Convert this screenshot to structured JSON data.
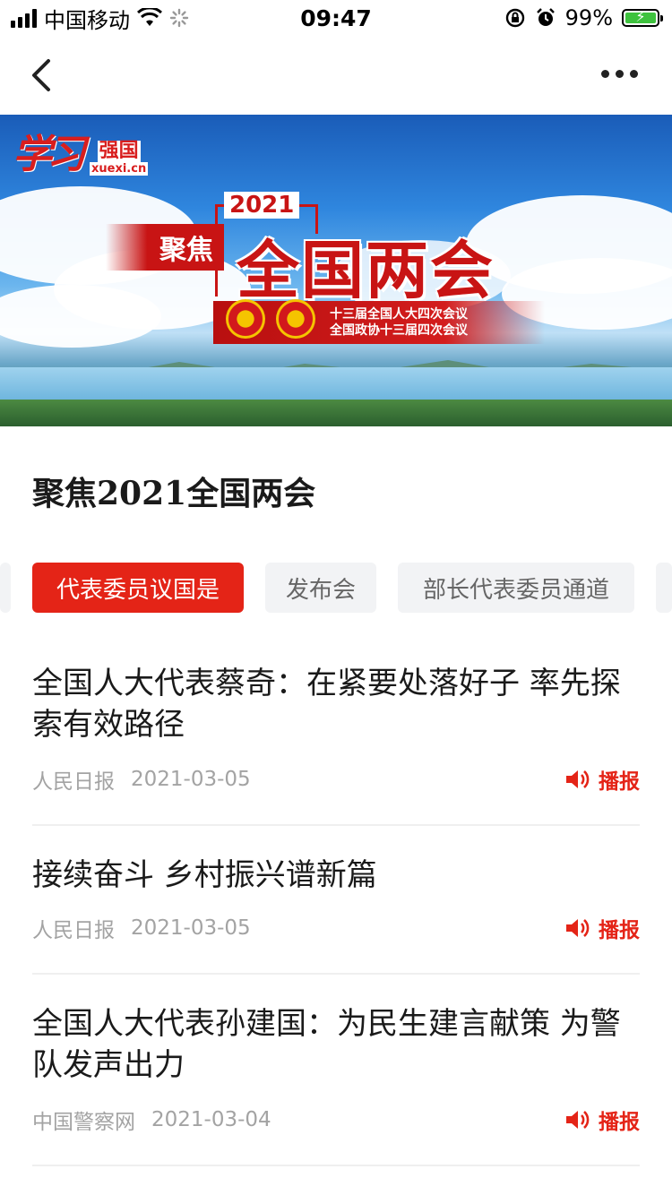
{
  "status_bar": {
    "carrier": "中国移动",
    "time": "09:47",
    "battery": "99%",
    "battery_level": 0.99
  },
  "nav": {
    "back_icon": "chevron-left-icon",
    "more_icon": "more-dots-icon"
  },
  "banner": {
    "logo_callig": "学习",
    "logo_brand": "强国",
    "logo_url": "xuexi.cn",
    "focus_tag": "聚焦",
    "year": "2021",
    "headline": "全国两会",
    "meeting_line1": "十三届全国人大四次会议",
    "meeting_line2": "全国政协十三届四次会议"
  },
  "page_title": "聚焦2021全国两会",
  "tabs": [
    {
      "label": "代表委员议国是",
      "active": true
    },
    {
      "label": "发布会",
      "active": false
    },
    {
      "label": "部长代表委员通道",
      "active": false
    }
  ],
  "articles": [
    {
      "title": "全国人大代表蔡奇：在紧要处落好子 率先探索有效路径",
      "source": "人民日报",
      "date": "2021-03-05",
      "play_label": "播报"
    },
    {
      "title": "接续奋斗 乡村振兴谱新篇",
      "source": "人民日报",
      "date": "2021-03-05",
      "play_label": "播报"
    },
    {
      "title": "全国人大代表孙建国：为民生建言献策 为警队发声出力",
      "source": "中国警察网",
      "date": "2021-03-04",
      "play_label": "播报"
    }
  ],
  "colors": {
    "accent": "#e42417",
    "tab_inactive_bg": "#f2f3f5",
    "meta_text": "#a3a3a3"
  }
}
